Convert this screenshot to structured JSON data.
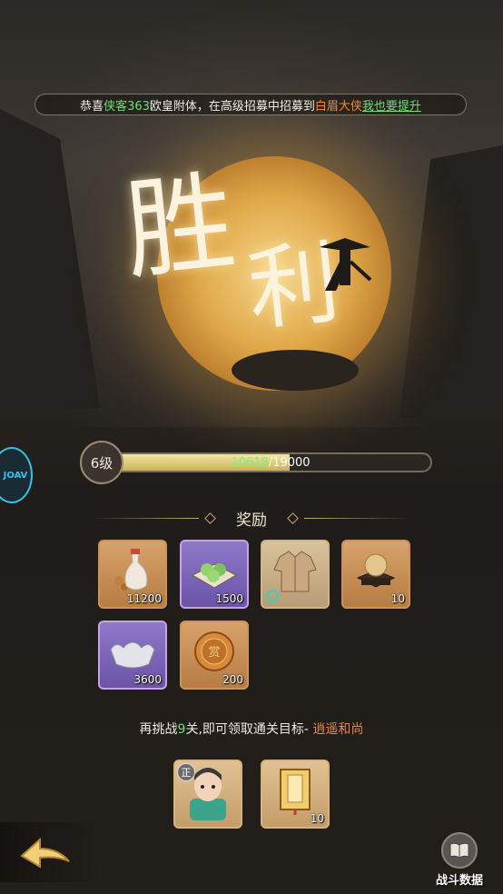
{
  "ticker": {
    "prefix": "恭喜",
    "player": "侠客363",
    "middle": "欧皇附体，在高级招募中招募到",
    "hero": "白眉大侠",
    "link": "我也要提升"
  },
  "result": {
    "title_char_1": "胜",
    "title_char_2": "利"
  },
  "side_badge": {
    "text": "JOAV"
  },
  "level": {
    "label": "6级",
    "current_xp": "10618",
    "separator": "/",
    "max_xp": "19000",
    "progress_fraction": 0.5588
  },
  "rewards": {
    "title": "奖励",
    "items": [
      {
        "name": "medicine-bottle",
        "count": "11200",
        "rarity": "orange"
      },
      {
        "name": "green-dumplings",
        "count": "1500",
        "rarity": "purple"
      },
      {
        "name": "cloth-robe",
        "count": "",
        "rarity": "tan"
      },
      {
        "name": "pearl-on-stand",
        "count": "10",
        "rarity": "orange"
      },
      {
        "name": "silver-ingot",
        "count": "3600",
        "rarity": "purple"
      },
      {
        "name": "gold-coin",
        "count": "200",
        "rarity": "orange"
      }
    ]
  },
  "challenge": {
    "prefix": "再挑战",
    "stages": "9",
    "middle": "关,即可领取通关目标-",
    "target": "逍遥和尚"
  },
  "target_rewards": [
    {
      "name": "hero-portrait",
      "badge": "正",
      "count": ""
    },
    {
      "name": "scroll-book",
      "count": "10"
    }
  ],
  "buttons": {
    "battle_data": "战斗数据"
  }
}
